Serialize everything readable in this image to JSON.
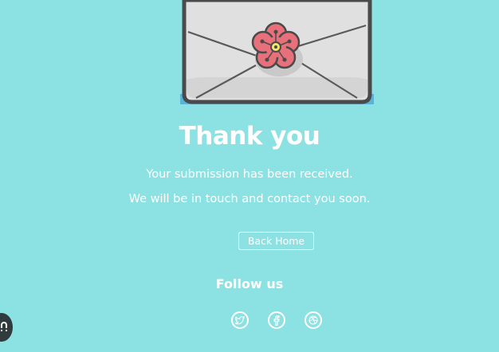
{
  "confirmation": {
    "title": "Thank you",
    "line1": "Your submission has been received.",
    "line2": "We will be in touch and contact you soon."
  },
  "actions": {
    "back_home_label": "Back Home"
  },
  "social": {
    "heading": "Follow us",
    "icons": [
      "twitter-icon",
      "facebook-icon",
      "dribbble-icon"
    ]
  },
  "colors": {
    "background": "#8ce1e3",
    "envelope": "#e0e0e0",
    "envelope_outline": "#4a4a4a",
    "flower": "#e8707a",
    "flower_center": "#f3e66d",
    "text": "#ffffff"
  }
}
